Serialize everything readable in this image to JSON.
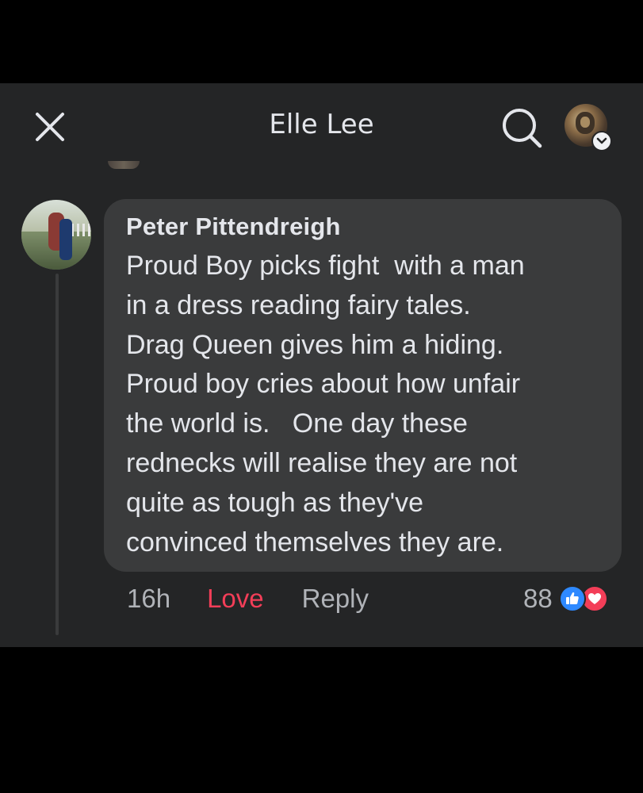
{
  "header": {
    "title": "Elle Lee",
    "icons": {
      "close": "close-icon",
      "search": "search-icon",
      "profile_chevron": "chevron-down-icon"
    }
  },
  "comment": {
    "author": "Peter Pittendreigh",
    "lines": [
      "Proud Boy picks fight  with a man",
      "in a dress reading fairy tales.",
      "Drag Queen gives him a hiding.",
      "Proud boy cries about how unfair",
      "the world is.   One day these",
      "rednecks will realise they are not",
      "quite as tough as they've",
      "convinced themselves they are."
    ],
    "time": "16h",
    "love_label": "Love",
    "reply_label": "Reply",
    "reaction_count": "88",
    "reaction_icons": [
      "like-icon",
      "love-icon"
    ]
  },
  "colors": {
    "background": "#242526",
    "bubble": "#3a3b3c",
    "text": "#e4e6eb",
    "secondary_text": "#b0b3b8",
    "love": "#f33e58",
    "like": "#2e89ff"
  }
}
